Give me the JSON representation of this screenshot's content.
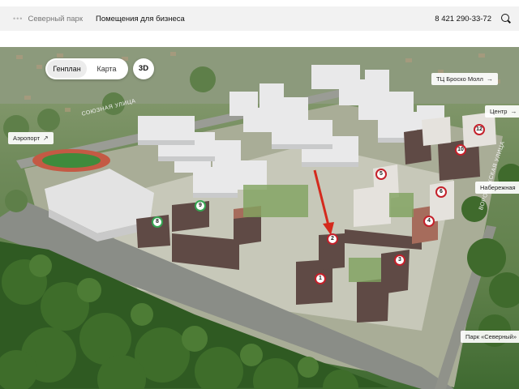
{
  "header": {
    "dots": "•••",
    "breadcrumb_park": "Северный парк",
    "breadcrumb_current": "Помещения для бизнеса",
    "phone": "8 421 290-33-72"
  },
  "controls": {
    "plan_label": "Генплан",
    "map_label": "Карта",
    "view_3d_label": "3D"
  },
  "poi": {
    "airport": "Аэропорт",
    "mall": "ТЦ Броско Молл",
    "center": "Центр",
    "embankment": "Набережная",
    "park": "Парк «Северный»"
  },
  "streets": {
    "soyuznaya": "СОЮЗНАЯ УЛИЦА",
    "voronezhskaya": "ВОРОНЕЖСКАЯ УЛИЦА"
  },
  "buildings": [
    "1",
    "2",
    "3",
    "4",
    "5",
    "6",
    "8",
    "9",
    "10",
    "12"
  ],
  "colors": {
    "marker_red": "#c4202a",
    "marker_green": "#35a552",
    "arrow_red": "#d42a1d"
  }
}
